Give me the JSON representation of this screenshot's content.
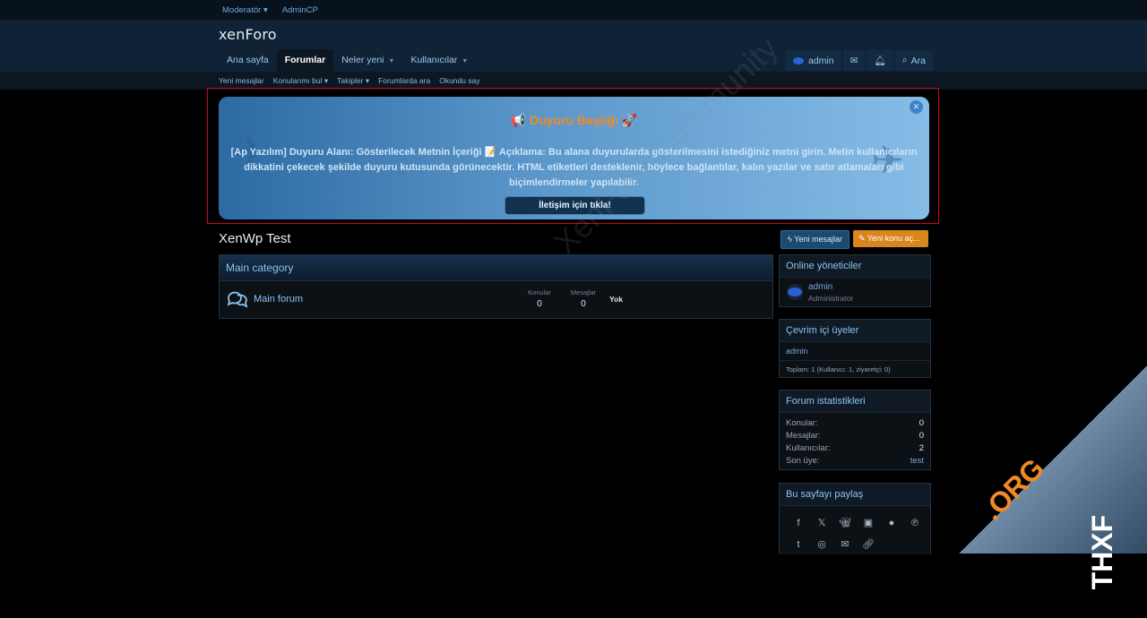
{
  "topbar": {
    "moderator": "Moderatör",
    "admincp": "AdminCP"
  },
  "logo": "xenForo",
  "nav": {
    "tabs": [
      {
        "label": "Ana sayfa"
      },
      {
        "label": "Forumlar"
      },
      {
        "label": "Neler yeni"
      },
      {
        "label": "Kullanıcılar"
      }
    ],
    "user": "admin",
    "search": "Ara"
  },
  "subnav": [
    "Yeni mesajlar",
    "Konularımı bul",
    "Takipler",
    "Forumlarda ara",
    "Okundu say"
  ],
  "announcement": {
    "title": "📢 Duyuru Başlığı 🚀",
    "body": "[Ap Yazılım] Duyuru Alanı: Gösterilecek Metnin İçeriği 📝 Açıklama: Bu alana duyurularda gösterilmesini istediğiniz metni girin. Metin kullanıcıların dikkatini çekecek şekilde duyuru kutusunda görünecektir. HTML etiketleri desteklenir, böylece bağlantılar, kalın yazılar ve satır atlamaları gibi biçimlendirmeler yapılabilir.",
    "button": "İletişim için tıkla!"
  },
  "watermark": "XenForo Community",
  "page": {
    "title": "XenWp Test",
    "new_posts": "Yeni mesajlar",
    "new_thread": "Yeni konu aç..."
  },
  "category": {
    "title": "Main category",
    "forum": "Main forum",
    "threads_label": "Konular",
    "threads_value": "0",
    "messages_label": "Mesajlar",
    "messages_value": "0",
    "last": "Yok"
  },
  "sidebar": {
    "staff_title": "Online yöneticiler",
    "staff_name": "admin",
    "staff_role": "Administrator",
    "online_title": "Çevrim içi üyeler",
    "online_user": "admin",
    "online_total": "Toplam: 1 (Kullanıcı: 1, ziyaretçi: 0)",
    "stats_title": "Forum istatistikleri",
    "stats": [
      {
        "label": "Konular:",
        "value": "0"
      },
      {
        "label": "Mesajlar:",
        "value": "0"
      },
      {
        "label": "Kullanıcılar:",
        "value": "2"
      },
      {
        "label": "Son üye:",
        "value": "test"
      }
    ],
    "share_title": "Bu sayfayı paylaş"
  },
  "corner_mark": {
    "a": "THXF",
    "b": ".ORG"
  },
  "colors": {
    "accent": "#8cc3f0",
    "orange": "#d9861e",
    "border_red": "#d1001f"
  }
}
